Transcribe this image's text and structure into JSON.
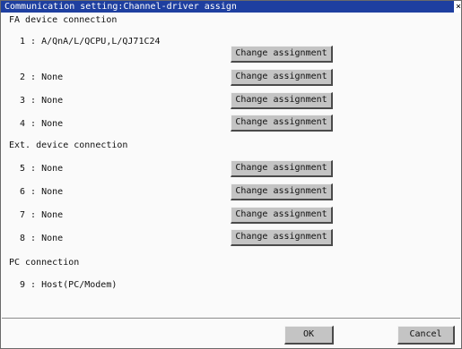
{
  "window": {
    "title": "Communication setting:Channel-driver assign",
    "close_glyph": "×"
  },
  "sections": {
    "fa": "FA device connection",
    "ext": "Ext. device connection",
    "pc": "PC connection"
  },
  "channels": [
    {
      "label": "1 : A/QnA/L/QCPU,L/QJ71C24",
      "button": "Change assignment"
    },
    {
      "label": "2 : None",
      "button": "Change assignment"
    },
    {
      "label": "3 : None",
      "button": "Change assignment"
    },
    {
      "label": "4 : None",
      "button": "Change assignment"
    },
    {
      "label": "5 : None",
      "button": "Change assignment"
    },
    {
      "label": "6 : None",
      "button": "Change assignment"
    },
    {
      "label": "7 : None",
      "button": "Change assignment"
    },
    {
      "label": "8 : None",
      "button": "Change assignment"
    },
    {
      "label": "9 : Host(PC/Modem)"
    }
  ],
  "footer": {
    "ok_label": "OK",
    "cancel_label": "Cancel"
  },
  "colors": {
    "titlebar": "#1e3fa0",
    "button_face": "#c4c4c4"
  }
}
